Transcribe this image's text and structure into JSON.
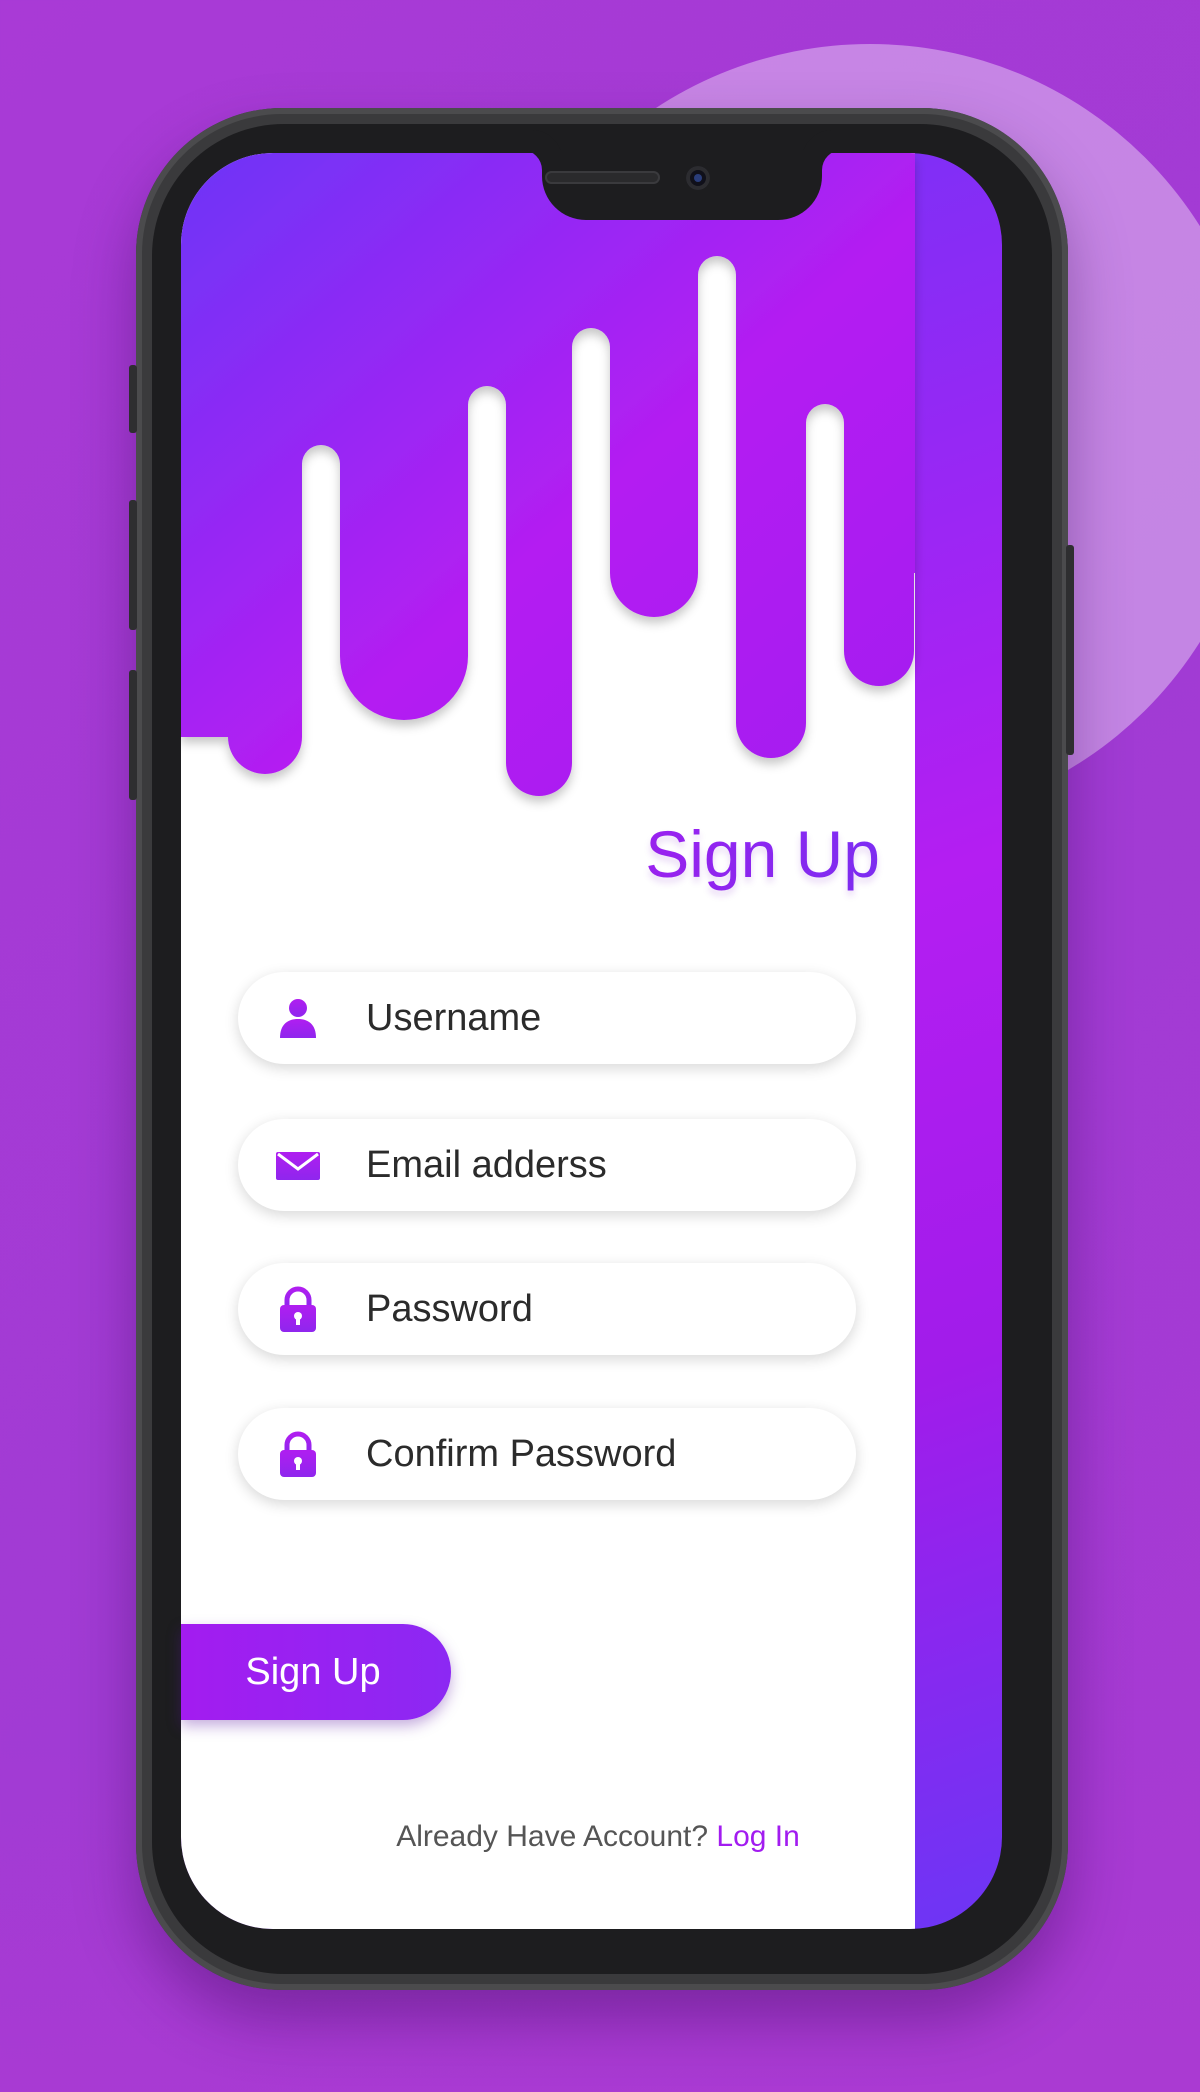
{
  "colors": {
    "background": "#a53ad4",
    "accent": "#a71ef0",
    "gradient_start": "#6d35f7",
    "gradient_end": "#b41ef2",
    "text": "#2b2b2b",
    "link": "#a21cf0"
  },
  "screen": {
    "title": "Sign Up",
    "fields": [
      {
        "icon": "user-icon",
        "placeholder": "Username"
      },
      {
        "icon": "envelope-icon",
        "placeholder": "Email adderss"
      },
      {
        "icon": "lock-icon",
        "placeholder": "Password"
      },
      {
        "icon": "lock-icon",
        "placeholder": "Confirm Password"
      }
    ],
    "submit_label": "Sign Up",
    "footer_text": "Already Have Account?",
    "login_link": "Log In"
  }
}
